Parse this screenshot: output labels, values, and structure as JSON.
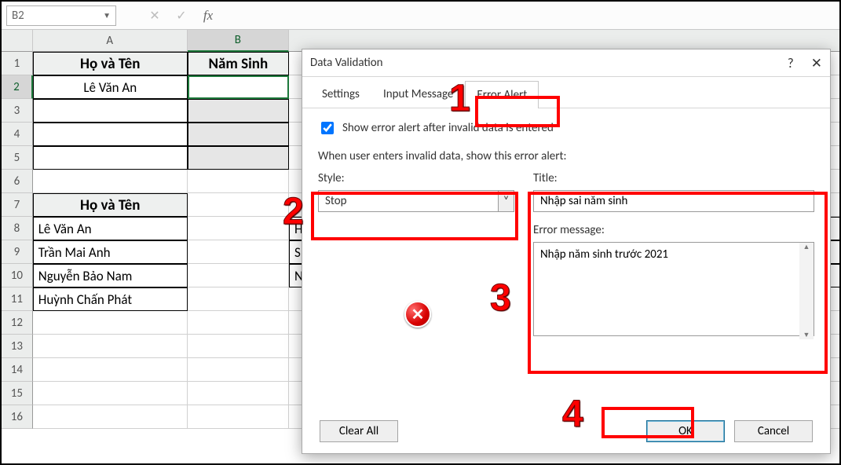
{
  "formula_bar": {
    "name_box": "B2",
    "formula": ""
  },
  "columns": [
    "A",
    "B"
  ],
  "rows": [
    "1",
    "2",
    "3",
    "4",
    "5",
    "6",
    "7",
    "8",
    "9",
    "10",
    "11",
    "12",
    "13",
    "14",
    "15",
    "16"
  ],
  "table1": {
    "headers": {
      "A": "Họ và Tên",
      "B": "Năm Sinh"
    },
    "data": {
      "r2A": "Lê Văn An",
      "r2B": "",
      "r3A": "",
      "r3B": "",
      "r4A": "",
      "r4B": "",
      "r5A": "",
      "r5B": ""
    }
  },
  "table2": {
    "header": "Họ và Tên",
    "rows": [
      "Lê Văn An",
      "Trần Mai Anh",
      "Nguyễn Bảo Nam",
      "Huỳnh Chấn Phát"
    ]
  },
  "colC_fragments": {
    "r8": "H",
    "r9": "S",
    "r10": "N"
  },
  "dialog": {
    "title": "Data Validation",
    "help": "?",
    "close": "✕",
    "tabs": {
      "settings": "Settings",
      "input": "Input Message",
      "error": "Error Alert"
    },
    "checkbox_label": "Show error alert after invalid data is entered",
    "subheading": "When user enters invalid data, show this error alert:",
    "style_label": "Style:",
    "style_value": "Stop",
    "title_label": "Title:",
    "title_value": "Nhập sai năm sinh",
    "errmsg_label": "Error message:",
    "errmsg_value": "Nhập năm sinh trước 2021",
    "clear": "Clear All",
    "ok": "OK",
    "cancel": "Cancel"
  },
  "annotations": {
    "n1": "1",
    "n2": "2",
    "n3": "3",
    "n4": "4"
  }
}
